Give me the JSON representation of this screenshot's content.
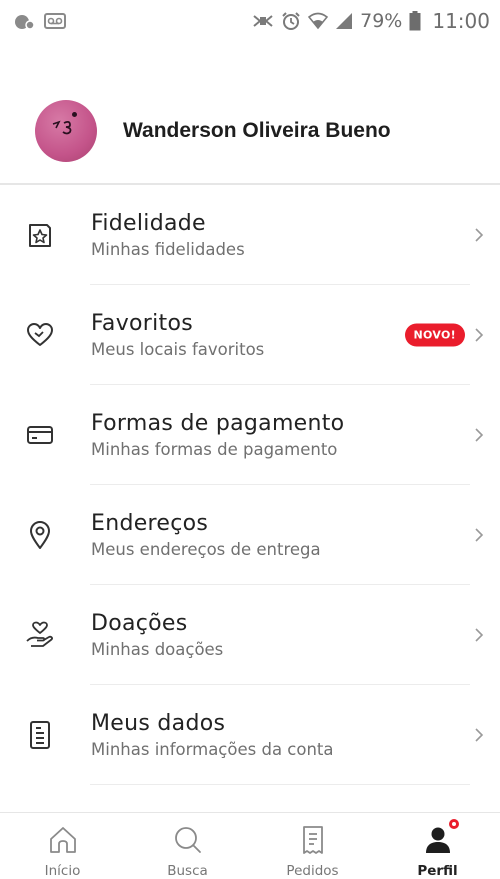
{
  "status_bar": {
    "battery_text": "79%",
    "time": "11:00",
    "left_icons": [
      "notification-badge-icon",
      "voicemail-icon"
    ],
    "right_icons": [
      "nfc-icon",
      "alarm-icon",
      "wifi-icon",
      "signal-icon",
      "battery-icon"
    ]
  },
  "profile": {
    "name": "Wanderson Oliveira Bueno"
  },
  "menu": {
    "items": [
      {
        "title": "Fidelidade",
        "subtitle": "Minhas fidelidades",
        "icon": "star-card-icon"
      },
      {
        "title": "Favoritos",
        "subtitle": "Meus locais favoritos",
        "icon": "heart-icon",
        "badge": "NOVO!"
      },
      {
        "title": "Formas de pagamento",
        "subtitle": "Minhas formas de pagamento",
        "icon": "credit-card-icon"
      },
      {
        "title": "Endereços",
        "subtitle": "Meus endereços de entrega",
        "icon": "location-pin-icon"
      },
      {
        "title": "Doações",
        "subtitle": "Minhas doações",
        "icon": "donation-hand-icon"
      },
      {
        "title": "Meus dados",
        "subtitle": "Minhas informações da conta",
        "icon": "document-icon"
      }
    ]
  },
  "bottom_nav": {
    "items": [
      {
        "label": "Início",
        "icon": "home-icon"
      },
      {
        "label": "Busca",
        "icon": "search-icon"
      },
      {
        "label": "Pedidos",
        "icon": "orders-icon"
      },
      {
        "label": "Perfil",
        "icon": "profile-icon",
        "active": true
      }
    ]
  },
  "colors": {
    "accent": "#ea1d2c",
    "text_primary": "#222222",
    "text_secondary": "#707070",
    "icon": "#3a3a3a",
    "avatar": "#c4548a"
  }
}
